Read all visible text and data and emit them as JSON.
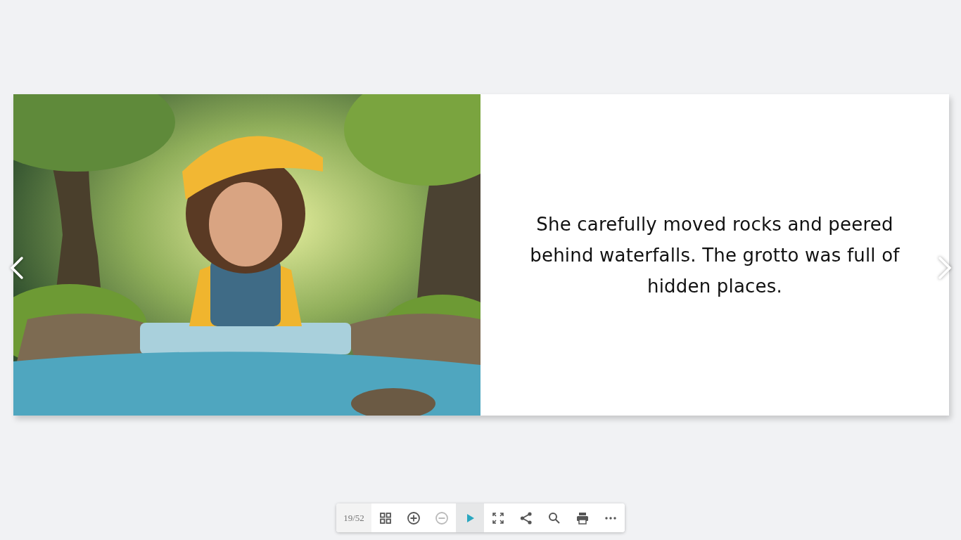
{
  "book": {
    "right_page": {
      "text": "She carefully moved rocks and peered behind waterfalls. The grotto was full of hidden places."
    }
  },
  "toolbar": {
    "page_counter": "19/52",
    "tools": [
      {
        "kind": "thumbnails",
        "disabled": false,
        "active": false
      },
      {
        "kind": "zoom-in",
        "disabled": false,
        "active": false
      },
      {
        "kind": "zoom-out",
        "disabled": true,
        "active": false
      },
      {
        "kind": "play",
        "disabled": false,
        "active": true
      },
      {
        "kind": "fullscreen",
        "disabled": false,
        "active": false
      },
      {
        "kind": "share",
        "disabled": false,
        "active": false
      },
      {
        "kind": "search",
        "disabled": false,
        "active": false
      },
      {
        "kind": "print",
        "disabled": false,
        "active": false
      },
      {
        "kind": "more",
        "disabled": false,
        "active": false
      }
    ]
  }
}
